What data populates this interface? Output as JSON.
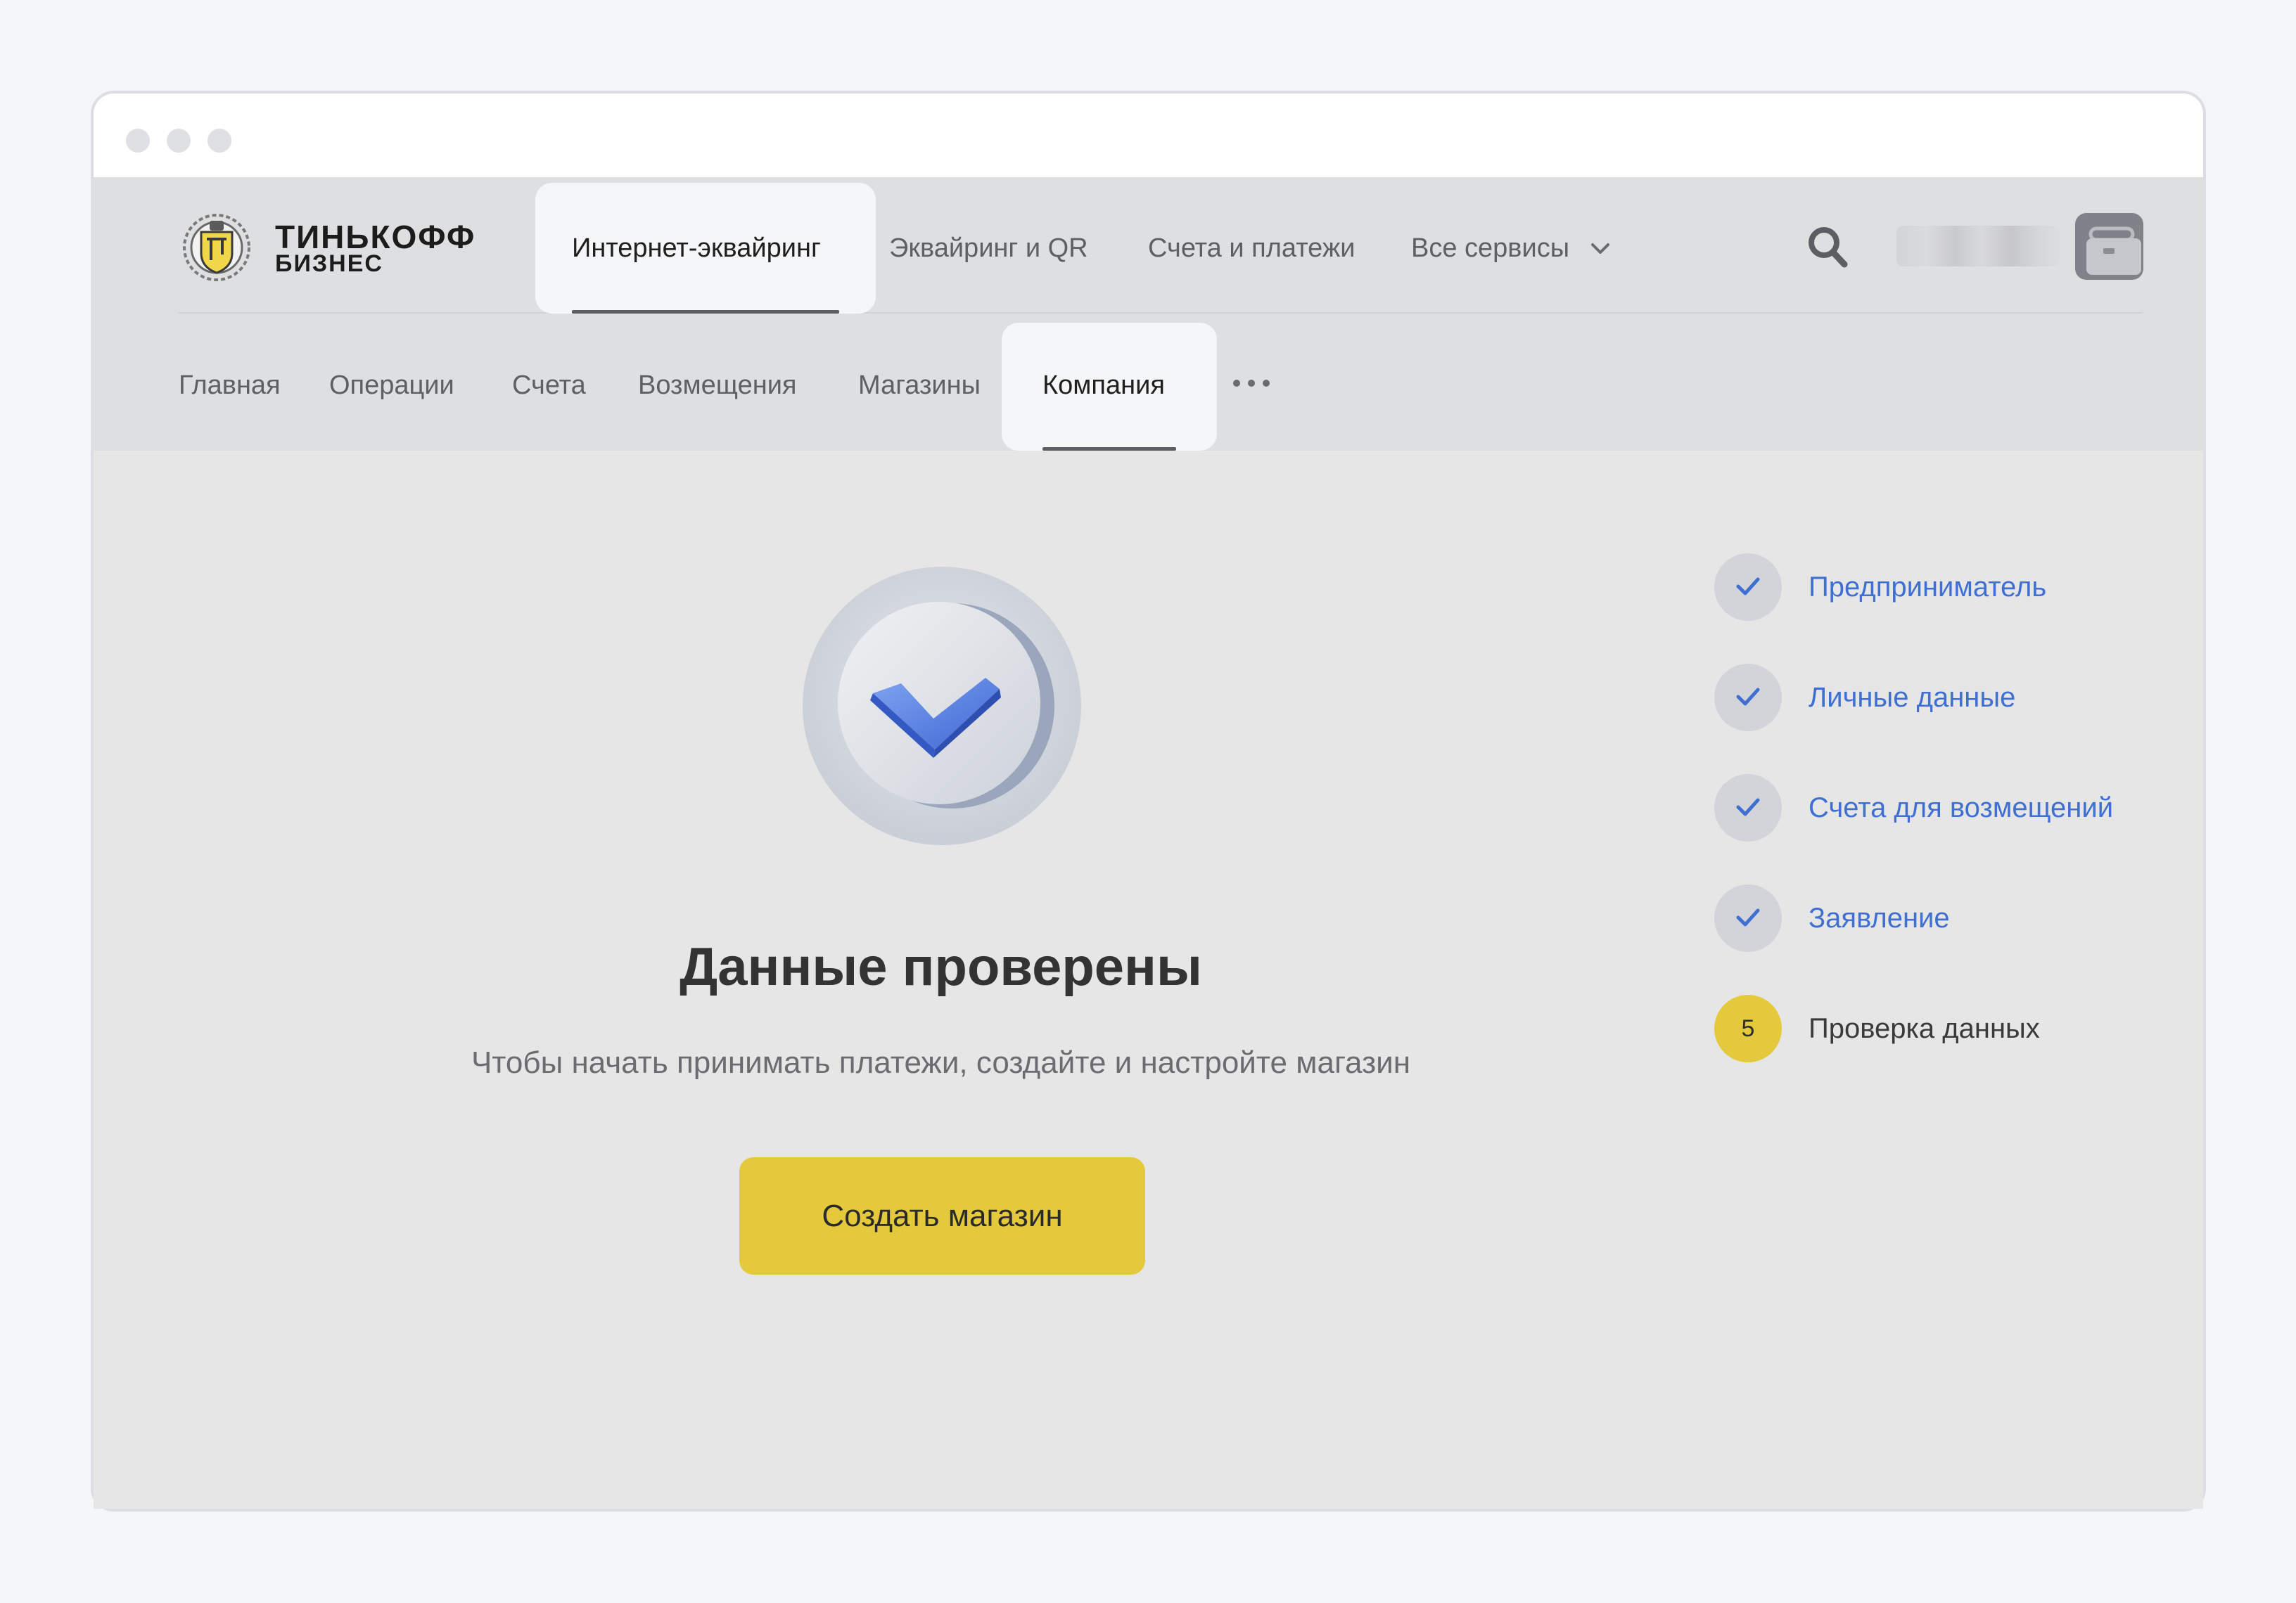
{
  "brand": {
    "line1": "ТИНЬКОФФ",
    "line2": "БИЗНЕС",
    "accent_color": "#e4c93c"
  },
  "topnav": {
    "tabs": [
      {
        "label": "Интернет-эквайринг",
        "active": true
      },
      {
        "label": "Эквайринг и QR",
        "active": false
      },
      {
        "label": "Счета и платежи",
        "active": false
      },
      {
        "label": "Все сервисы",
        "active": false,
        "icon": "chevron-down-icon"
      }
    ],
    "search_icon": "search-icon",
    "avatar_icon": "briefcase-icon"
  },
  "subnav": {
    "tabs": [
      {
        "label": "Главная",
        "active": false
      },
      {
        "label": "Операции",
        "active": false
      },
      {
        "label": "Счета",
        "active": false
      },
      {
        "label": "Возмещения",
        "active": false
      },
      {
        "label": "Магазины",
        "active": false
      },
      {
        "label": "Компания",
        "active": true
      }
    ],
    "more_label": "•••"
  },
  "main": {
    "badge_icon": "check-badge-icon",
    "title": "Данные проверены",
    "subtitle": "Чтобы начать принимать платежи, создайте и настройте магазин",
    "button_label": "Создать магазин"
  },
  "steps": [
    {
      "label": "Предприниматель",
      "status": "done"
    },
    {
      "label": "Личные данные",
      "status": "done"
    },
    {
      "label": "Счета для возмещений",
      "status": "done"
    },
    {
      "label": "Заявление",
      "status": "done"
    },
    {
      "label": "Проверка данных",
      "status": "current",
      "number": "5"
    }
  ],
  "colors": {
    "link_blue": "#3f6fd0",
    "check_blue": "#4f7fe0",
    "button_yellow": "#e4c93c"
  }
}
